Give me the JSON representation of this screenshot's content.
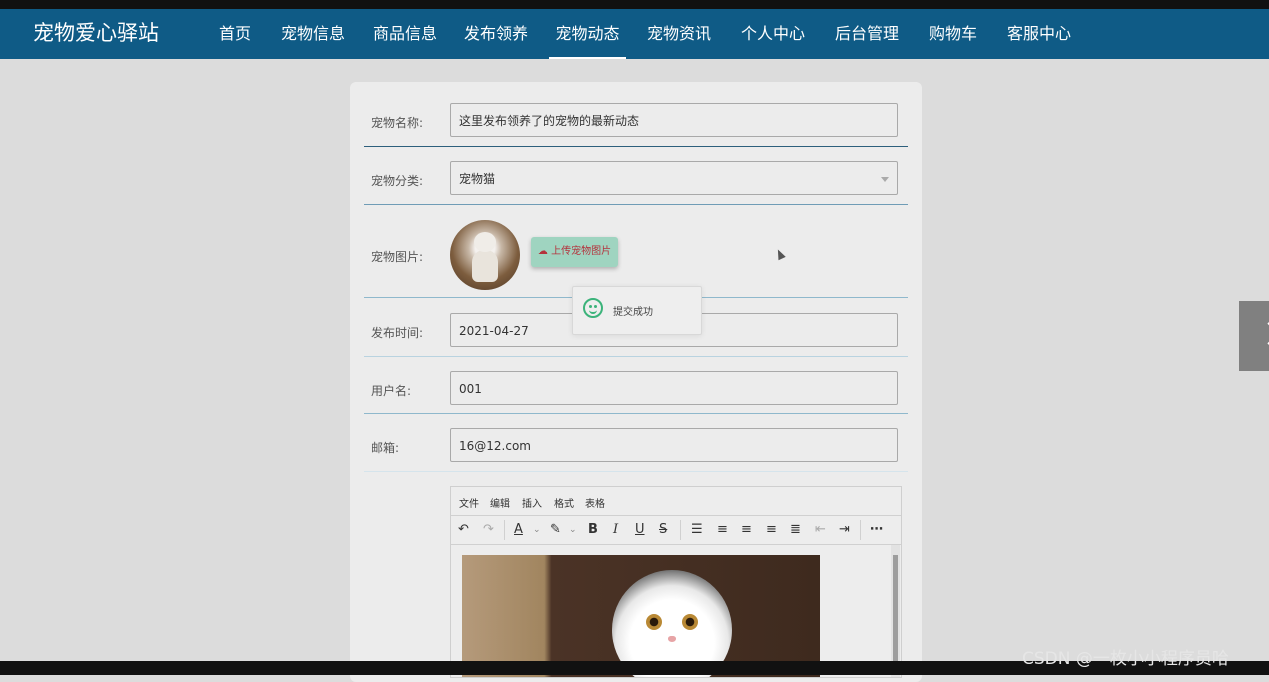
{
  "brand": "宠物爱心驿站",
  "nav": [
    {
      "label": "首页"
    },
    {
      "label": "宠物信息"
    },
    {
      "label": "商品信息"
    },
    {
      "label": "发布领养"
    },
    {
      "label": "宠物动态",
      "active": true
    },
    {
      "label": "宠物资讯"
    },
    {
      "label": "个人中心"
    },
    {
      "label": "后台管理"
    },
    {
      "label": "购物车"
    },
    {
      "label": "客服中心"
    }
  ],
  "form": {
    "pet_name_label": "宠物名称:",
    "pet_name_value": "这里发布领养了的宠物的最新动态",
    "category_label": "宠物分类:",
    "category_value": "宠物猫",
    "image_label": "宠物图片:",
    "upload_button": "上传宠物图片",
    "publish_time_label": "发布时间:",
    "publish_time_value": "2021-04-27",
    "username_label": "用户名:",
    "username_value": "001",
    "email_label": "邮箱:",
    "email_value": "16@12.com"
  },
  "toast": {
    "message": "提交成功"
  },
  "editor": {
    "menus": [
      "文件",
      "编辑",
      "插入",
      "格式",
      "表格"
    ],
    "toolbar_icons": [
      "undo-icon",
      "redo-icon",
      "text-color-icon",
      "highlight-icon",
      "bold-icon",
      "italic-icon",
      "underline-icon",
      "strikethrough-icon",
      "list-icon",
      "align-left-icon",
      "align-center-icon",
      "align-right-icon",
      "justify-icon",
      "outdent-icon",
      "indent-icon",
      "more-icon"
    ]
  },
  "watermark": "CSDN @一枚小小程序员哈",
  "colors": {
    "navbar": "#0f5b86",
    "upload_button": "#9fd4c0",
    "success": "#3bb37a"
  }
}
